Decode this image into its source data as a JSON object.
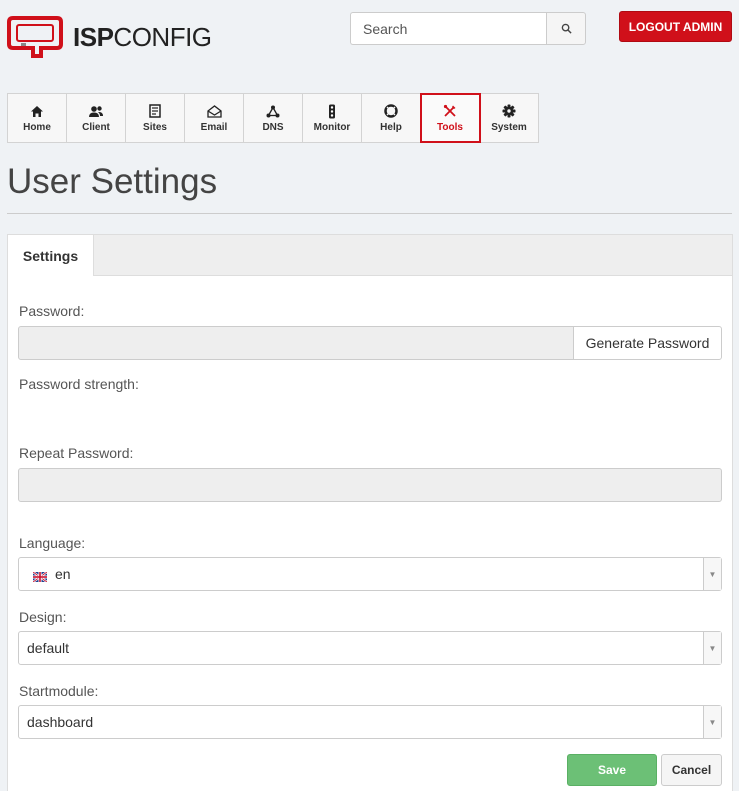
{
  "header": {
    "logo_bold": "ISP",
    "logo_light": "CONFIG",
    "search_placeholder": "Search",
    "logout_label": "LOGOUT ADMIN"
  },
  "nav": {
    "items": [
      {
        "label": "Home",
        "icon": "home-icon"
      },
      {
        "label": "Client",
        "icon": "client-icon"
      },
      {
        "label": "Sites",
        "icon": "sites-icon"
      },
      {
        "label": "Email",
        "icon": "email-icon"
      },
      {
        "label": "DNS",
        "icon": "dns-icon"
      },
      {
        "label": "Monitor",
        "icon": "monitor-icon"
      },
      {
        "label": "Help",
        "icon": "help-icon"
      },
      {
        "label": "Tools",
        "icon": "tools-icon"
      },
      {
        "label": "System",
        "icon": "gear-icon"
      }
    ],
    "active": "Tools"
  },
  "page": {
    "title": "User Settings"
  },
  "form": {
    "tab_label": "Settings",
    "password_label": "Password:",
    "password_value": "",
    "generate_label": "Generate Password",
    "strength_label": "Password strength:",
    "repeat_label": "Repeat Password:",
    "repeat_value": "",
    "language_label": "Language:",
    "language_value": "en",
    "design_label": "Design:",
    "design_value": "default",
    "startmodule_label": "Startmodule:",
    "startmodule_value": "dashboard",
    "save_label": "Save",
    "cancel_label": "Cancel"
  },
  "colors": {
    "brand_red": "#d0101a",
    "save_green": "#6cc076",
    "background": "#eff2f5"
  }
}
